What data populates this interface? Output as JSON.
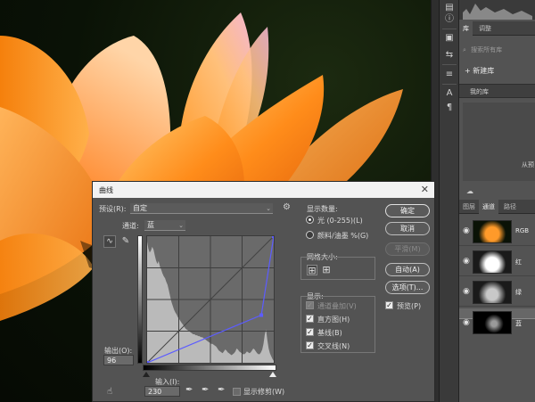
{
  "dialog": {
    "title": "曲线",
    "preset_label": "预设(R):",
    "preset_value": "自定",
    "channel_label": "通道:",
    "channel_value": "蓝",
    "output_label": "输出(O):",
    "output_value": "96",
    "input_label": "输入(I):",
    "input_value": "230",
    "show_clipping_label": "显示修剪(W)",
    "show_clipping_checked": false,
    "show_amount_label": "显示数量:",
    "light_option": "光 (0-255)(L)",
    "pigment_option": "颜料/油墨 %(G)",
    "light_selected": true,
    "grid_size_label": "网格大小:",
    "show_label": "显示:",
    "show_items": [
      {
        "label": "通道叠加(V)",
        "checked": true,
        "disabled": true
      },
      {
        "label": "直方图(H)",
        "checked": true,
        "disabled": false
      },
      {
        "label": "基线(B)",
        "checked": true,
        "disabled": false
      },
      {
        "label": "交叉线(N)",
        "checked": true,
        "disabled": false
      }
    ],
    "buttons": {
      "ok": "确定",
      "cancel": "取消",
      "smooth": "平滑(M)",
      "auto": "自动(A)",
      "options": "选项(T)..."
    },
    "preview_label": "预览(P)",
    "preview_checked": true,
    "curve": {
      "points": [
        [
          0,
          0
        ],
        [
          230,
          96
        ],
        [
          255,
          255
        ]
      ],
      "histogram": [
        255,
        240,
        232,
        236,
        244,
        238,
        226,
        215,
        208,
        214,
        203,
        196,
        188,
        182,
        178,
        170,
        164,
        152,
        140,
        128,
        120,
        112,
        106,
        102,
        96,
        92,
        88,
        84,
        80,
        76,
        72,
        70,
        68,
        66,
        64,
        62,
        60,
        60,
        58,
        58,
        56,
        56,
        54,
        54,
        52,
        50,
        48,
        46,
        44,
        42,
        40,
        40,
        38,
        36,
        34,
        30,
        26,
        24,
        22,
        20,
        24,
        28,
        26,
        22,
        20,
        18,
        16,
        18,
        20,
        24,
        30,
        28,
        24,
        22,
        20,
        18,
        18,
        20,
        24,
        22,
        20,
        22,
        26,
        30,
        28,
        24,
        20,
        18,
        18,
        22,
        28,
        40,
        60,
        70,
        48,
        30,
        20,
        14,
        8,
        4
      ]
    }
  },
  "panels": {
    "library_tab": "库",
    "adjust_tab": "调整",
    "search_placeholder": "搜索所有库",
    "new_library": "新建库",
    "my_library": "我的库",
    "lib_partial": "从预",
    "layers_tab": "图层",
    "channels_tab": "通道",
    "paths_tab": "路径",
    "channels": [
      {
        "name": "RGB",
        "selected": false
      },
      {
        "name": "红",
        "selected": false
      },
      {
        "name": "绿",
        "selected": false
      },
      {
        "name": "蓝",
        "selected": true
      }
    ]
  },
  "icons": {
    "close": "close-icon",
    "gear": "gear-icon",
    "curve_tool": "curve-point-tool-icon",
    "pencil_tool": "pencil-icon",
    "hand_tool": "targeted-adjustment-icon",
    "black_eyedropper": "eyedropper-black-icon",
    "gray_eyedropper": "eyedropper-gray-icon",
    "white_eyedropper": "eyedropper-white-icon",
    "eye": "eye-icon"
  },
  "colors": {
    "curve": "#5c5cff",
    "histogram": "#c8c8c8",
    "panel": "#535353"
  }
}
